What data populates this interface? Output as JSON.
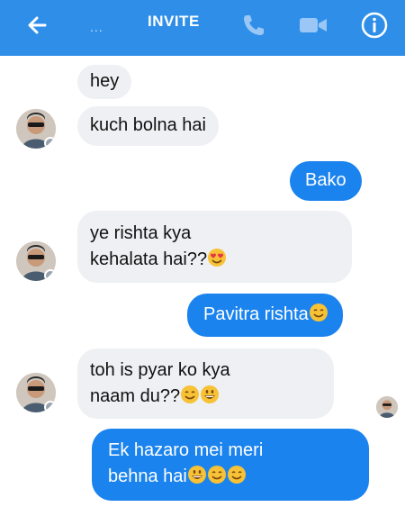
{
  "header": {
    "title": "INVITE",
    "dots": "...",
    "icons": [
      "back-arrow-icon",
      "phone-icon",
      "video-camera-icon",
      "info-icon"
    ],
    "color": "#2f8fe8"
  },
  "messages": {
    "m1": "hey",
    "m2": "kuch bolna hai",
    "m3": "Bako",
    "m4a": "ye rishta kya",
    "m4b": "kehalata hai??",
    "m5": "Pavitra rishta",
    "m6a": "toh is pyar ko kya",
    "m6b": "naam du??",
    "m7a": "Ek hazaro mei meri",
    "m7b": "behna hai"
  },
  "colors": {
    "incoming_bubble": "#eef0f3",
    "outgoing_bubble": "#1a83ee"
  }
}
